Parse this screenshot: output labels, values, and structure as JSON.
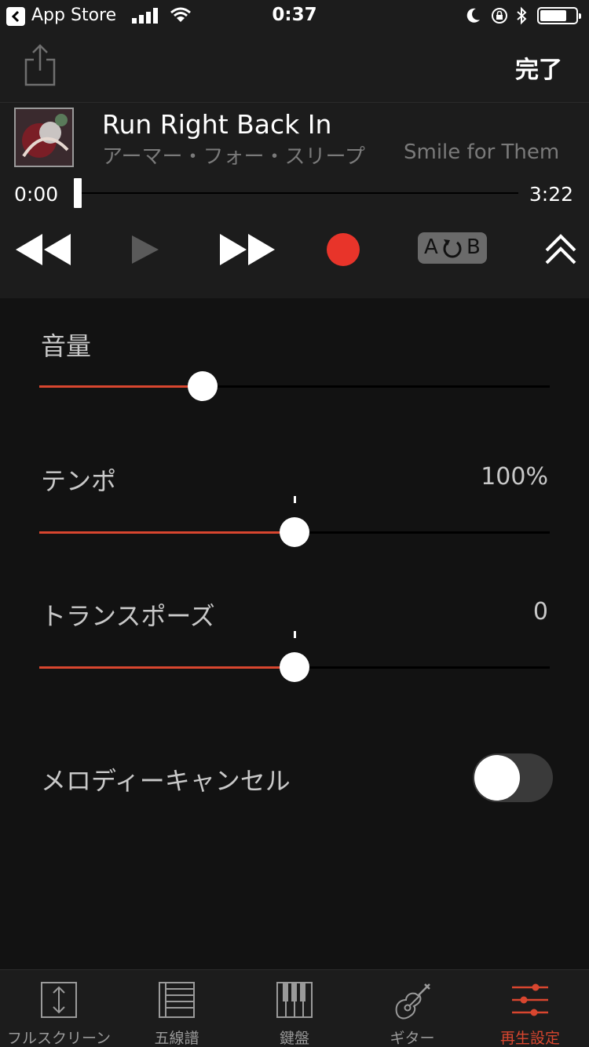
{
  "status_bar": {
    "back_app": "App Store",
    "time": "0:37",
    "icons": [
      "back-icon",
      "signal-icon",
      "wifi-icon",
      "moon-icon",
      "rotation-lock-icon",
      "bluetooth-icon",
      "battery-icon"
    ],
    "battery_level": 0.75
  },
  "nav": {
    "done_label": "完了",
    "share_icon": "share-icon"
  },
  "track": {
    "title": "Run Right Back In",
    "artist": "アーマー・フォー・スリープ",
    "album": "Smile for Them",
    "current_time": "0:00",
    "total_time": "3:22",
    "progress": 0.0
  },
  "controls": {
    "icons": [
      "rewind-icon",
      "play-icon",
      "fast-forward-icon",
      "record-icon",
      "ab-repeat-icon",
      "collapse-icon"
    ],
    "ab_label_a": "A",
    "ab_label_b": "B"
  },
  "settings": {
    "volume": {
      "label": "音量",
      "level": 0.32
    },
    "tempo": {
      "label": "テンポ",
      "value": "100%",
      "level": 0.5
    },
    "transpose": {
      "label": "トランスポーズ",
      "value": "0",
      "level": 0.5
    },
    "melody_cancel": {
      "label": "メロディーキャンセル",
      "enabled": false
    }
  },
  "tabs": [
    {
      "label": "フルスクリーン",
      "icon": "fullscreen-icon",
      "active": false
    },
    {
      "label": "五線譜",
      "icon": "staff-notation-icon",
      "active": false
    },
    {
      "label": "鍵盤",
      "icon": "keyboard-icon",
      "active": false
    },
    {
      "label": "ギター",
      "icon": "guitar-icon",
      "active": false
    },
    {
      "label": "再生設定",
      "icon": "playback-settings-icon",
      "active": true
    }
  ],
  "colors": {
    "accent": "#d8462f",
    "record": "#e8342a",
    "background": "#121212",
    "bar_background": "#1c1c1c",
    "secondary_text": "#7a7a7a"
  }
}
